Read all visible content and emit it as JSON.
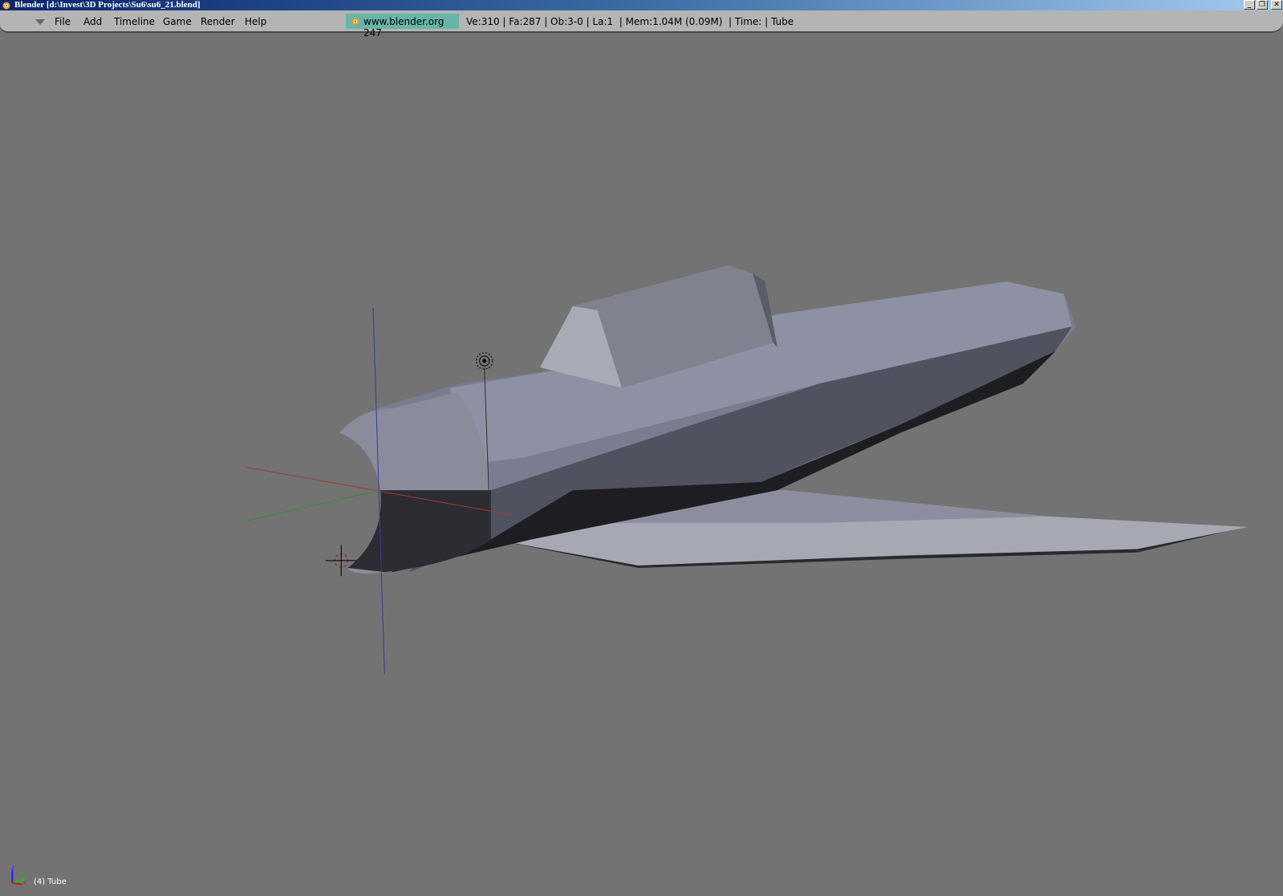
{
  "window": {
    "title": "Blender [d:\\Invest\\3D Projects\\Su6\\su6_21.blend]",
    "minimize": "_",
    "restore": "❐",
    "close": "✕"
  },
  "menubar": {
    "items": [
      "File",
      "Add",
      "Timeline",
      "Game",
      "Render",
      "Help"
    ],
    "badge": "www.blender.org 247",
    "stats": "Ve:310 | Fa:287 | Ob:3-0 | La:1  | Mem:1.04M (0.09M)  | Time: | Tube"
  },
  "viewport": {
    "object_label": "(4) Tube",
    "axis_z": "z",
    "axis_y": "y",
    "axis_x": "x",
    "background": "#737373",
    "mesh_color": "#8a8ca0"
  }
}
